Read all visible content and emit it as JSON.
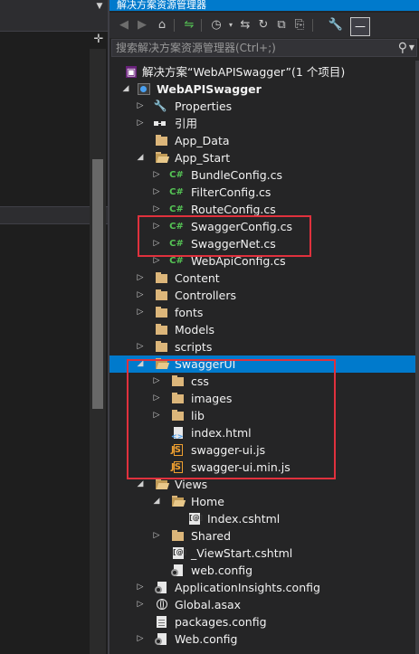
{
  "panel": {
    "title": "解决方案资源管理器",
    "search_placeholder": "搜索解决方案资源管理器(Ctrl+;)"
  },
  "toolbar": {
    "icons": [
      "back-icon",
      "forward-icon",
      "home-icon",
      "switch-views-icon",
      "pending-changes-icon",
      "sync-icon",
      "collapse-all-icon",
      "show-all-files-icon",
      "properties-icon",
      "preview-icon"
    ]
  },
  "tree": {
    "solution": "解决方案“WebAPISwagger”(1 个项目)",
    "project": "WebAPISwagger",
    "items": [
      {
        "label": "Properties"
      },
      {
        "label": "引用"
      },
      {
        "label": "App_Data"
      },
      {
        "label": "App_Start"
      },
      {
        "label": "BundleConfig.cs"
      },
      {
        "label": "FilterConfig.cs"
      },
      {
        "label": "RouteConfig.cs"
      },
      {
        "label": "SwaggerConfig.cs"
      },
      {
        "label": "SwaggerNet.cs"
      },
      {
        "label": "WebApiConfig.cs"
      },
      {
        "label": "Content"
      },
      {
        "label": "Controllers"
      },
      {
        "label": "fonts"
      },
      {
        "label": "Models"
      },
      {
        "label": "scripts"
      },
      {
        "label": "SwaggerUI"
      },
      {
        "label": "css"
      },
      {
        "label": "images"
      },
      {
        "label": "lib"
      },
      {
        "label": "index.html"
      },
      {
        "label": "swagger-ui.js"
      },
      {
        "label": "swagger-ui.min.js"
      },
      {
        "label": "Views"
      },
      {
        "label": "Home"
      },
      {
        "label": "Index.cshtml"
      },
      {
        "label": "Shared"
      },
      {
        "label": "_ViewStart.cshtml"
      },
      {
        "label": "web.config"
      },
      {
        "label": "ApplicationInsights.config"
      },
      {
        "label": "Global.asax"
      },
      {
        "label": "packages.config"
      },
      {
        "label": "Web.config"
      }
    ]
  },
  "colors": {
    "selection": "#007acc",
    "highlight_box": "#e0313d",
    "folder": "#dcb67a",
    "csharp": "#55c455"
  }
}
